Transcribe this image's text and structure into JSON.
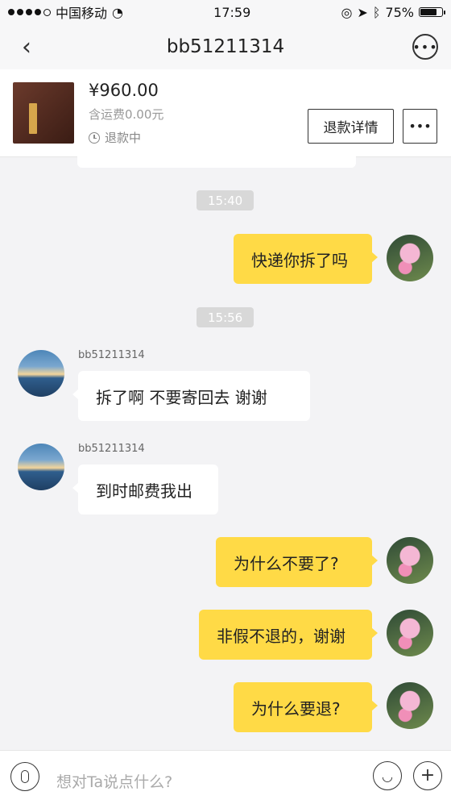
{
  "status_bar": {
    "carrier": "中国移动",
    "time": "17:59",
    "battery": "75%"
  },
  "header": {
    "title": "bb51211314"
  },
  "product": {
    "price": "¥960.00",
    "shipping": "含运费0.00元",
    "status": "退款中",
    "refund_button": "退款详情",
    "more_button": "•••"
  },
  "timestamps": [
    "15:40",
    "15:56"
  ],
  "messages": [
    {
      "side": "out",
      "text": "快递你拆了吗"
    },
    {
      "side": "in",
      "name": "bb51211314",
      "text": "拆了啊 不要寄回去 谢谢"
    },
    {
      "side": "in",
      "name": "bb51211314",
      "text": "到时邮费我出"
    },
    {
      "side": "out",
      "text": "为什么不要了?"
    },
    {
      "side": "out",
      "text": "非假不退的，谢谢"
    },
    {
      "side": "out",
      "text": "为什么要退?"
    }
  ],
  "input": {
    "placeholder": "想对Ta说点什么?"
  },
  "icons": {
    "back": "back-chevron-icon",
    "more": "more-dots-icon",
    "clock": "clock-icon",
    "mic": "microphone-icon",
    "emoji": "emoji-icon",
    "plus": "plus-icon"
  }
}
